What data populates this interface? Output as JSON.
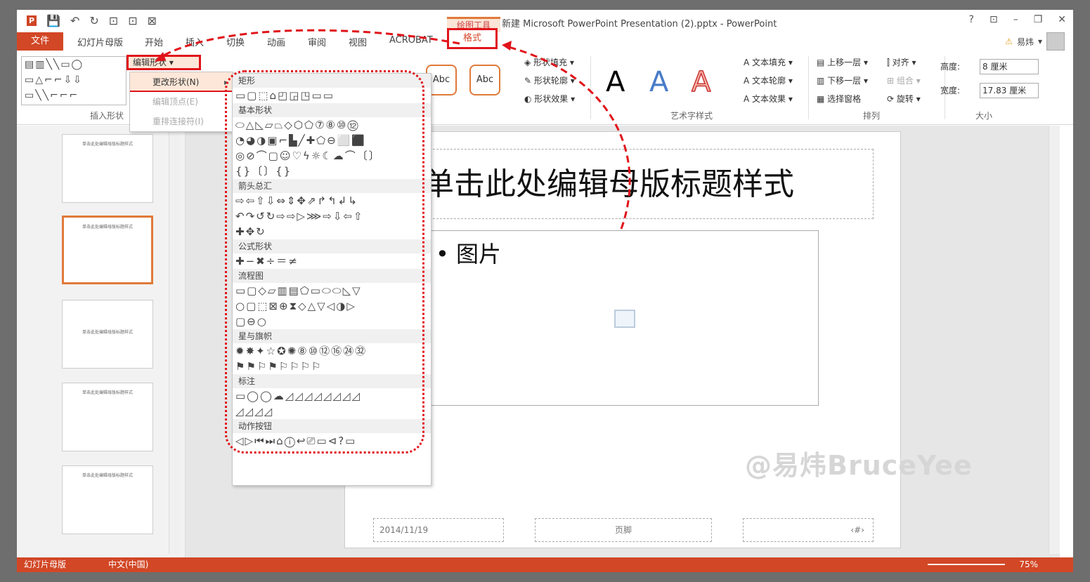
{
  "app": {
    "title": "新建 Microsoft PowerPoint Presentation (2).pptx - PowerPoint",
    "context_tab": "绘图工具",
    "logo": "P",
    "window_controls": [
      "?",
      "⊡",
      "–",
      "❐",
      "✕"
    ]
  },
  "qat": [
    "💾",
    "↶",
    "↻",
    "⊡",
    "⊡",
    "⊠"
  ],
  "tabs": {
    "file": "文件",
    "items": [
      "幻灯片母版",
      "开始",
      "插入",
      "切换",
      "动画",
      "审阅",
      "视图",
      "ACROBAT",
      "格式"
    ]
  },
  "user": {
    "name": "易炜",
    "warn": "⚠"
  },
  "ribbon": {
    "edit_shape": "编辑形状",
    "insert_shapes_label": "插入形状",
    "shape_fill": "形状填充",
    "shape_outline": "形状轮廓",
    "shape_effect": "形状效果",
    "style_samples": [
      "Abc",
      "Abc"
    ],
    "art_letters": [
      "A",
      "A",
      "A"
    ],
    "art_label": "艺术字样式",
    "text_fill": "文本填充",
    "text_outline": "文本轮廓",
    "text_effect": "文本效果",
    "bring_forward": "上移一层",
    "send_backward": "下移一层",
    "selection_pane": "选择窗格",
    "align": "对齐",
    "group": "组合",
    "rotate": "旋转",
    "arrange_label": "排列",
    "height_label": "高度:",
    "height_value": "8 厘米",
    "width_label": "宽度:",
    "width_value": "17.83 厘米",
    "size_label": "大小"
  },
  "submenu": [
    "更改形状(N)",
    "编辑顶点(E)",
    "重排连接符(I)"
  ],
  "gallery": {
    "sections": [
      {
        "title": "矩形",
        "shapes": "▭▢⬚⌂◰◲◳▭▭"
      },
      {
        "title": "基本形状",
        "shapes": "⬭△◺▱⏢◇⬡⬠⑦⑧⑩⑫\n◔◕◑▣⌐▙╱✚⬠⊖⬜⬛\n◎⊘⌒▢☺♡ϟ☼☾☁⌒〔〕\n{}〔〕{}"
      },
      {
        "title": "箭头总汇",
        "shapes": "⇨⇦⇧⇩⇔⇕✥⇗↱↰↲↳\n↶↷↺↻⇨⇨▷⋙⇨⇩⇦⇧\n✚✥↻"
      },
      {
        "title": "公式形状",
        "shapes": "✚−✖÷＝≠"
      },
      {
        "title": "流程图",
        "shapes": "▭▢◇▱▥▤⬠▭⬭⬭◺▽\n○▢⬚⊠⊕⧗◇△▽◁◑▷\n▢⊖○"
      },
      {
        "title": "星与旗帜",
        "shapes": "✹✸✦☆✪✺⑧⑩⑫⑯㉔㉜\n⚑⚑⚐⚑⚐⚐⚐⚐"
      },
      {
        "title": "标注",
        "shapes": "▭◯◯☁◿◿◿◿◿◿◿◿\n◿◿◿◿"
      },
      {
        "title": "动作按钮",
        "shapes": "◁▷⏮⏭⌂ⓘ↩⎚▭⊲?▭"
      }
    ]
  },
  "thumbs": [
    "单击此处编辑母版标题样式",
    "单击此处编辑母版标题样式",
    "单击此处编辑母版标题样式",
    "单击此处编辑母版标题样式",
    "单击此处编辑母版标题样式"
  ],
  "slide": {
    "title": "单击此处编辑母版标题样式",
    "bullet": "• 图片",
    "date": "2014/11/19",
    "footer": "页脚",
    "number": "‹#›"
  },
  "watermark": "@易炜BruceYee",
  "status": {
    "left": "幻灯片母版",
    "lang": "中文(中国)",
    "zoom": "75%"
  },
  "colors": {
    "accent": "#d24726",
    "highlight": "#e0141a"
  }
}
